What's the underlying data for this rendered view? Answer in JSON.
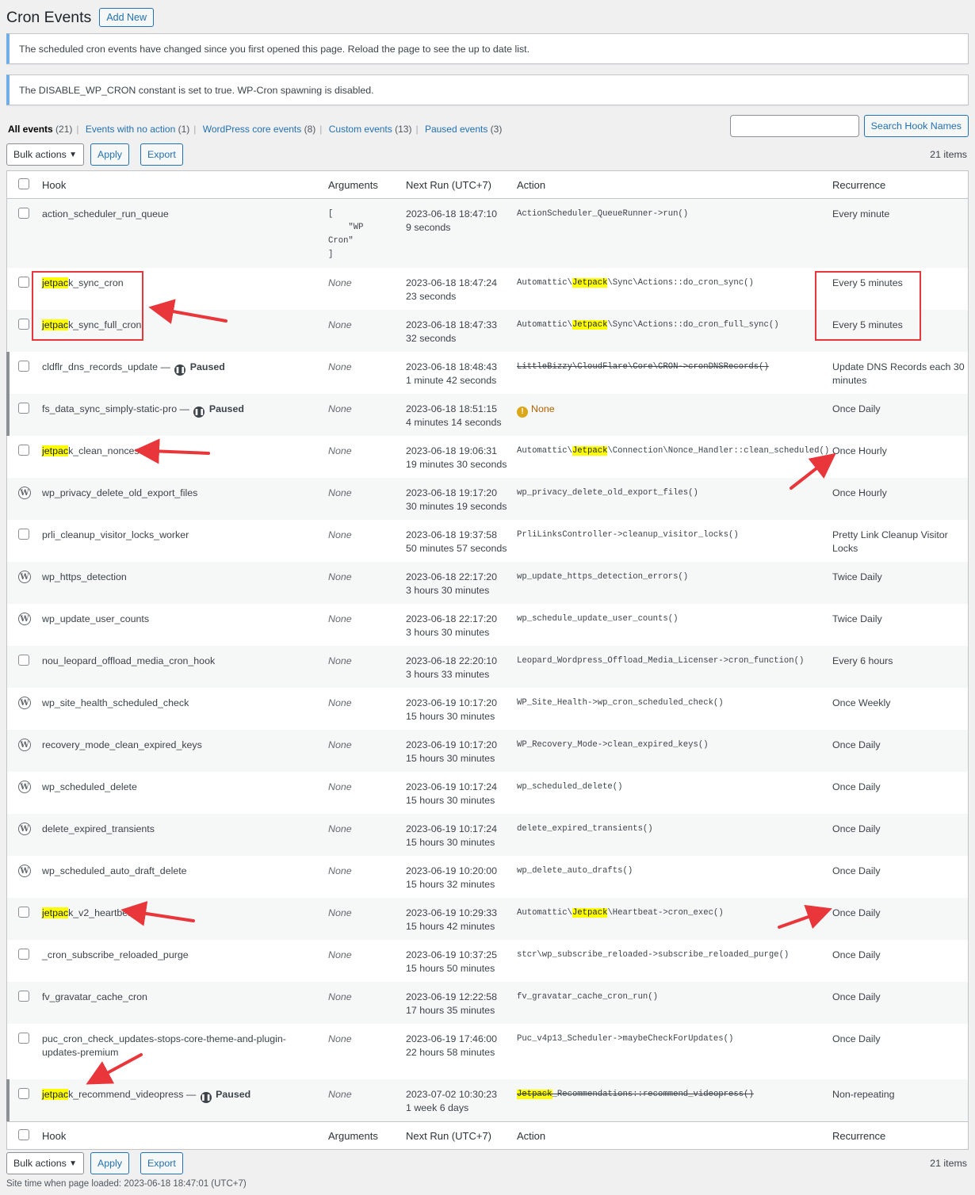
{
  "header": {
    "title": "Cron Events",
    "add_new": "Add New"
  },
  "notices": [
    "The scheduled cron events have changed since you first opened this page. Reload the page to see the up to date list.",
    "The DISABLE_WP_CRON constant is set to true. WP-Cron spawning is disabled."
  ],
  "views": [
    {
      "label": "All events",
      "count": "(21)",
      "current": true
    },
    {
      "label": "Events with no action",
      "count": "(1)"
    },
    {
      "label": "WordPress core events",
      "count": "(8)"
    },
    {
      "label": "Custom events",
      "count": "(13)"
    },
    {
      "label": "Paused events",
      "count": "(3)"
    }
  ],
  "search": {
    "button": "Search Hook Names",
    "value": ""
  },
  "tablenav": {
    "bulk": "Bulk actions",
    "apply": "Apply",
    "export": "Export",
    "items": "21 items"
  },
  "columns": {
    "hook": "Hook",
    "arguments": "Arguments",
    "next_run": "Next Run (UTC+7)",
    "action": "Action",
    "recurrence": "Recurrence"
  },
  "paused_label": "Paused",
  "none_label": "None",
  "rows": [
    {
      "hook": "action_scheduler_run_queue",
      "args_lines": [
        "[",
        "    \"WP",
        "Cron\"",
        "]"
      ],
      "next": "2023-06-18 18:47:10",
      "eta": "9 seconds",
      "action": "ActionScheduler_QueueRunner->run()",
      "rec": "Every minute",
      "h": 87
    },
    {
      "hook_hl": "jetpac",
      "hook": "k_sync_cron",
      "next": "2023-06-18 18:47:24",
      "eta": "23 seconds",
      "action_pre": "Automattic\\",
      "action_hl": "Jetpack",
      "action": "\\Sync\\Actions::do_cron_sync()",
      "rec": "Every 5 minutes",
      "h": 53
    },
    {
      "hook_hl": "jetpac",
      "hook": "k_sync_full_cron",
      "next": "2023-06-18 18:47:33",
      "eta": "32 seconds",
      "action_pre": "Automattic\\",
      "action_hl": "Jetpack",
      "action": "\\Sync\\Actions::do_cron_full_sync()",
      "rec": "Every 5 minutes",
      "h": 53
    },
    {
      "hook": "cldflr_dns_records_update",
      "paused": true,
      "next": "2023-06-18 18:48:43",
      "eta": "1 minute 42 seconds",
      "action": "LittleBizzy\\CloudFlare\\Core\\CRON->cronDNSRecords()",
      "strike": true,
      "rec": "Update DNS Records each 30 minutes",
      "h": 53
    },
    {
      "hook": "fs_data_sync_simply-static-pro",
      "paused": true,
      "next": "2023-06-18 18:51:15",
      "eta": "4 minutes 14 seconds",
      "action": "None",
      "warn": true,
      "rec": "Once Daily",
      "h": 53
    },
    {
      "hook_hl": "jetpac",
      "hook": "k_clean_nonces",
      "next": "2023-06-18 19:06:31",
      "eta": "19 minutes 30 seconds",
      "action_pre": "Automattic\\",
      "action_hl": "Jetpack",
      "action": "\\Connection\\Nonce_Handler::clean_scheduled()",
      "rec": "Once Hourly",
      "h": 53
    },
    {
      "core": true,
      "hook": "wp_privacy_delete_old_export_files",
      "next": "2023-06-18 19:17:20",
      "eta": "30 minutes 19 seconds",
      "action": "wp_privacy_delete_old_export_files()",
      "rec": "Once Hourly",
      "h": 53
    },
    {
      "hook": "prli_cleanup_visitor_locks_worker",
      "next": "2023-06-18 19:37:58",
      "eta": "50 minutes 57 seconds",
      "action": "PrliLinksController->cleanup_visitor_locks()",
      "rec": "Pretty Link Cleanup Visitor Locks",
      "h": 53
    },
    {
      "core": true,
      "hook": "wp_https_detection",
      "next": "2023-06-18 22:17:20",
      "eta": "3 hours 30 minutes",
      "action": "wp_update_https_detection_errors()",
      "rec": "Twice Daily",
      "h": 53
    },
    {
      "core": true,
      "hook": "wp_update_user_counts",
      "next": "2023-06-18 22:17:20",
      "eta": "3 hours 30 minutes",
      "action": "wp_schedule_update_user_counts()",
      "rec": "Twice Daily",
      "h": 53
    },
    {
      "hook": "nou_leopard_offload_media_cron_hook",
      "next": "2023-06-18 22:20:10",
      "eta": "3 hours 33 minutes",
      "action": "Leopard_Wordpress_Offload_Media_Licenser->cron_function()",
      "rec": "Every 6 hours",
      "h": 53
    },
    {
      "core": true,
      "hook": "wp_site_health_scheduled_check",
      "next": "2023-06-19 10:17:20",
      "eta": "15 hours 30 minutes",
      "action": "WP_Site_Health->wp_cron_scheduled_check()",
      "rec": "Once Weekly",
      "h": 53
    },
    {
      "core": true,
      "hook": "recovery_mode_clean_expired_keys",
      "next": "2023-06-19 10:17:20",
      "eta": "15 hours 30 minutes",
      "action": "WP_Recovery_Mode->clean_expired_keys()",
      "rec": "Once Daily",
      "h": 53
    },
    {
      "core": true,
      "hook": "wp_scheduled_delete",
      "next": "2023-06-19 10:17:24",
      "eta": "15 hours 30 minutes",
      "action": "wp_scheduled_delete()",
      "rec": "Once Daily",
      "h": 53
    },
    {
      "core": true,
      "hook": "delete_expired_transients",
      "next": "2023-06-19 10:17:24",
      "eta": "15 hours 30 minutes",
      "action": "delete_expired_transients()",
      "rec": "Once Daily",
      "h": 53
    },
    {
      "core": true,
      "hook": "wp_scheduled_auto_draft_delete",
      "next": "2023-06-19 10:20:00",
      "eta": "15 hours 32 minutes",
      "action": "wp_delete_auto_drafts()",
      "rec": "Once Daily",
      "h": 53
    },
    {
      "hook_hl": "jetpac",
      "hook": "k_v2_heartbeat",
      "next": "2023-06-19 10:29:33",
      "eta": "15 hours 42 minutes",
      "action_pre": "Automattic\\",
      "action_hl": "Jetpack",
      "action": "\\Heartbeat->cron_exec()",
      "rec": "Once Daily",
      "h": 53
    },
    {
      "hook": "_cron_subscribe_reloaded_purge",
      "next": "2023-06-19 10:37:25",
      "eta": "15 hours 50 minutes",
      "action": "stcr\\wp_subscribe_reloaded->subscribe_reloaded_purge()",
      "rec": "Once Daily",
      "h": 53
    },
    {
      "hook": "fv_gravatar_cache_cron",
      "next": "2023-06-19 12:22:58",
      "eta": "17 hours 35 minutes",
      "action": "fv_gravatar_cache_cron_run()",
      "rec": "Once Daily",
      "h": 53
    },
    {
      "hook": "puc_cron_check_updates-stops-core-theme-and-plugin-updates-premium",
      "next": "2023-06-19 17:46:00",
      "eta": "22 hours 58 minutes",
      "action": "Puc_v4p13_Scheduler->maybeCheckForUpdates()",
      "rec": "Once Daily",
      "h": 70
    },
    {
      "hook_hl": "jetpac",
      "hook": "k_recommend_videopress",
      "paused": true,
      "next": "2023-07-02 10:30:23",
      "eta": "1 week 6 days",
      "action_hl": "Jetpack",
      "action": "_Recommendations::recommend_videopress()",
      "strike": true,
      "rec": "Non-repeating",
      "h": 53
    }
  ],
  "footer": "Site time when page loaded: 2023-06-18 18:47:01 (UTC+7)",
  "colors": {
    "link": "#2271b1",
    "highlight": "#ffff00",
    "annotation": "#e8363b",
    "notice_border": "#72aee6"
  }
}
